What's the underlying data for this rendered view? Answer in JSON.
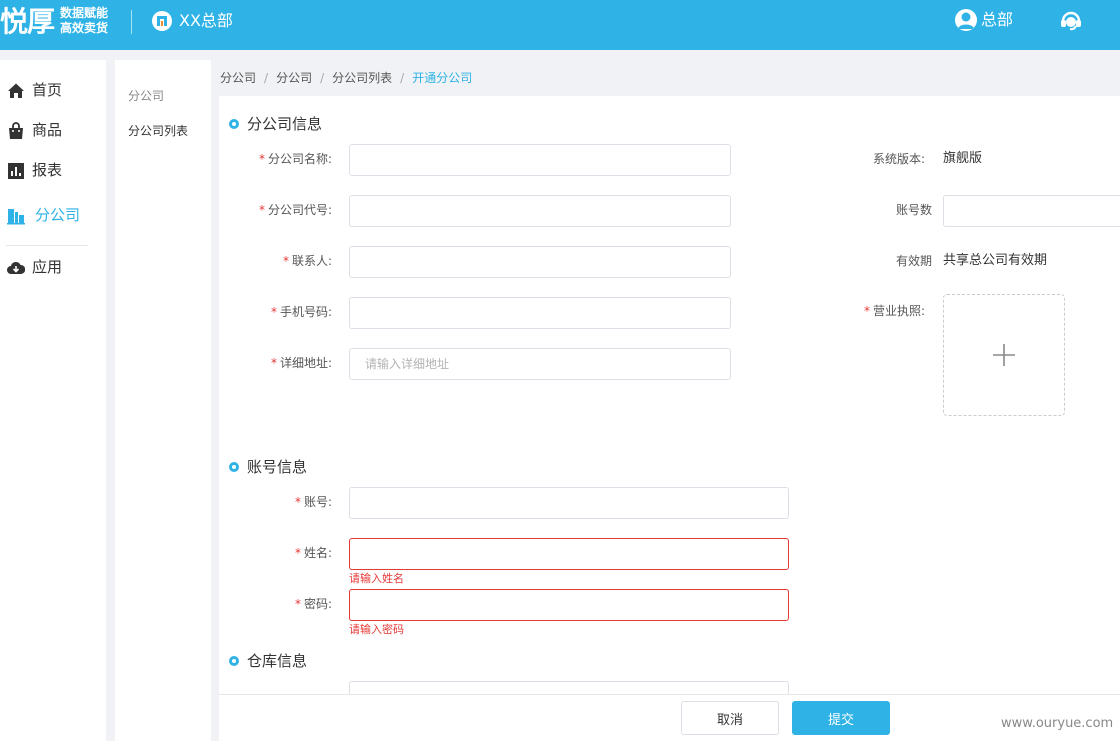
{
  "brand": {
    "logo_main": "悦厚",
    "logo_sub_line1": "数据赋能",
    "logo_sub_line2": "高效卖货",
    "org_name": "XX总部",
    "user_name": "总部",
    "accent_color": "#2fb3e6"
  },
  "sidebar": {
    "items": [
      {
        "label": "首页",
        "icon": "home-icon"
      },
      {
        "label": "商品",
        "icon": "shopping-bag-icon"
      },
      {
        "label": "报表",
        "icon": "bar-chart-icon"
      },
      {
        "label": "分公司",
        "icon": "building-icon",
        "active": true
      },
      {
        "label": "应用",
        "icon": "cloud-download-icon"
      }
    ]
  },
  "subnav": {
    "title": "分公司",
    "items": [
      "分公司列表"
    ]
  },
  "breadcrumb": [
    "分公司",
    "分公司",
    "分公司列表",
    "开通分公司"
  ],
  "form": {
    "branch_section": {
      "title": "分公司信息",
      "name_label": "分公司名称:",
      "code_label": "分公司代号:",
      "contact_label": "联系人:",
      "phone_label": "手机号码:",
      "address_label": "详细地址:",
      "address_placeholder": "请输入详细地址",
      "version_label": "系统版本:",
      "version_value": "旗舰版",
      "accounts_label": "账号数",
      "validity_label": "有效期",
      "validity_value": "共享总公司有效期",
      "license_label": "营业执照:"
    },
    "account_section": {
      "title": "账号信息",
      "account_label": "账号:",
      "name_label": "姓名:",
      "name_error": "请输入姓名",
      "password_label": "密码:",
      "password_error": "请输入密码"
    },
    "warehouse_section": {
      "title": "仓库信息"
    }
  },
  "footer": {
    "cancel_label": "取消",
    "submit_label": "提交"
  },
  "watermark": "www.ouryue.com"
}
